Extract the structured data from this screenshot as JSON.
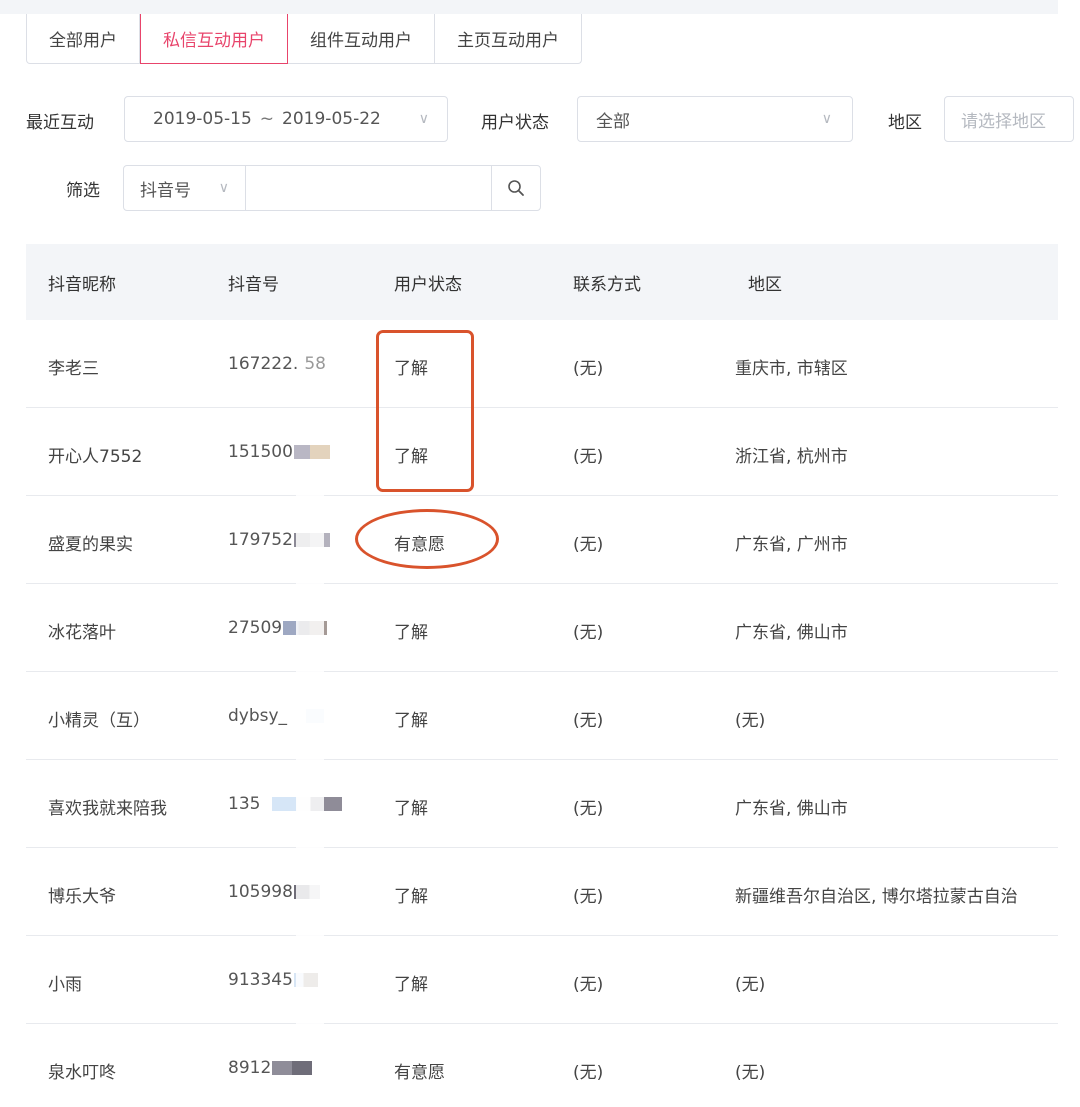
{
  "tabs": [
    {
      "label": "全部用户",
      "active": false
    },
    {
      "label": "私信互动用户",
      "active": true
    },
    {
      "label": "组件互动用户",
      "active": false
    },
    {
      "label": "主页互动用户",
      "active": false
    }
  ],
  "filters": {
    "recent_label": "最近互动",
    "date_start": "2019-05-15",
    "date_sep": "~",
    "date_end": "2019-05-22",
    "status_label": "用户状态",
    "status_value": "全部",
    "region_label": "地区",
    "region_placeholder": "请选择地区",
    "filter_label": "筛选",
    "filter_type": "抖音号",
    "filter_value": ""
  },
  "table": {
    "headers": [
      "抖音昵称",
      "抖音号",
      "用户状态",
      "联系方式",
      "地区"
    ],
    "rows": [
      {
        "nickname": "李老三",
        "douyin_id": "167222.",
        "id_tail": "58",
        "status": "了解",
        "contact": "(无)",
        "region": "重庆市, 市辖区"
      },
      {
        "nickname": "开心人7552",
        "douyin_id": "151500",
        "id_tail": "",
        "status": "了解",
        "contact": "(无)",
        "region": "浙江省, 杭州市"
      },
      {
        "nickname": "盛夏的果实",
        "douyin_id": "179752",
        "id_tail": "",
        "status": "有意愿",
        "contact": "(无)",
        "region": "广东省, 广州市"
      },
      {
        "nickname": "冰花落叶",
        "douyin_id": "27509",
        "id_tail": "",
        "status": "了解",
        "contact": "(无)",
        "region": "广东省, 佛山市"
      },
      {
        "nickname": "小精灵（互）",
        "douyin_id": "dybsy_",
        "id_tail": "",
        "status": "了解",
        "contact": "(无)",
        "region": "(无)"
      },
      {
        "nickname": "喜欢我就来陪我",
        "douyin_id": "135",
        "id_tail": "",
        "status": "了解",
        "contact": "(无)",
        "region": "广东省, 佛山市"
      },
      {
        "nickname": "博乐大爷",
        "douyin_id": "105998",
        "id_tail": "",
        "status": "了解",
        "contact": "(无)",
        "region": "新疆维吾尔自治区, 博尔塔拉蒙古自治"
      },
      {
        "nickname": "小雨",
        "douyin_id": "913345",
        "id_tail": "",
        "status": "了解",
        "contact": "(无)",
        "region": "(无)"
      },
      {
        "nickname": "泉水叮咚",
        "douyin_id": "8912",
        "id_tail": "",
        "status": "有意愿",
        "contact": "(无)",
        "region": "(无)"
      }
    ]
  },
  "icons": {
    "search": "search-icon",
    "chevron": "chevron-down-icon"
  },
  "colors": {
    "accent": "#e8446b",
    "annotation": "#d9532c",
    "header_bg": "#f3f5f8",
    "border": "#dcdfe6"
  }
}
